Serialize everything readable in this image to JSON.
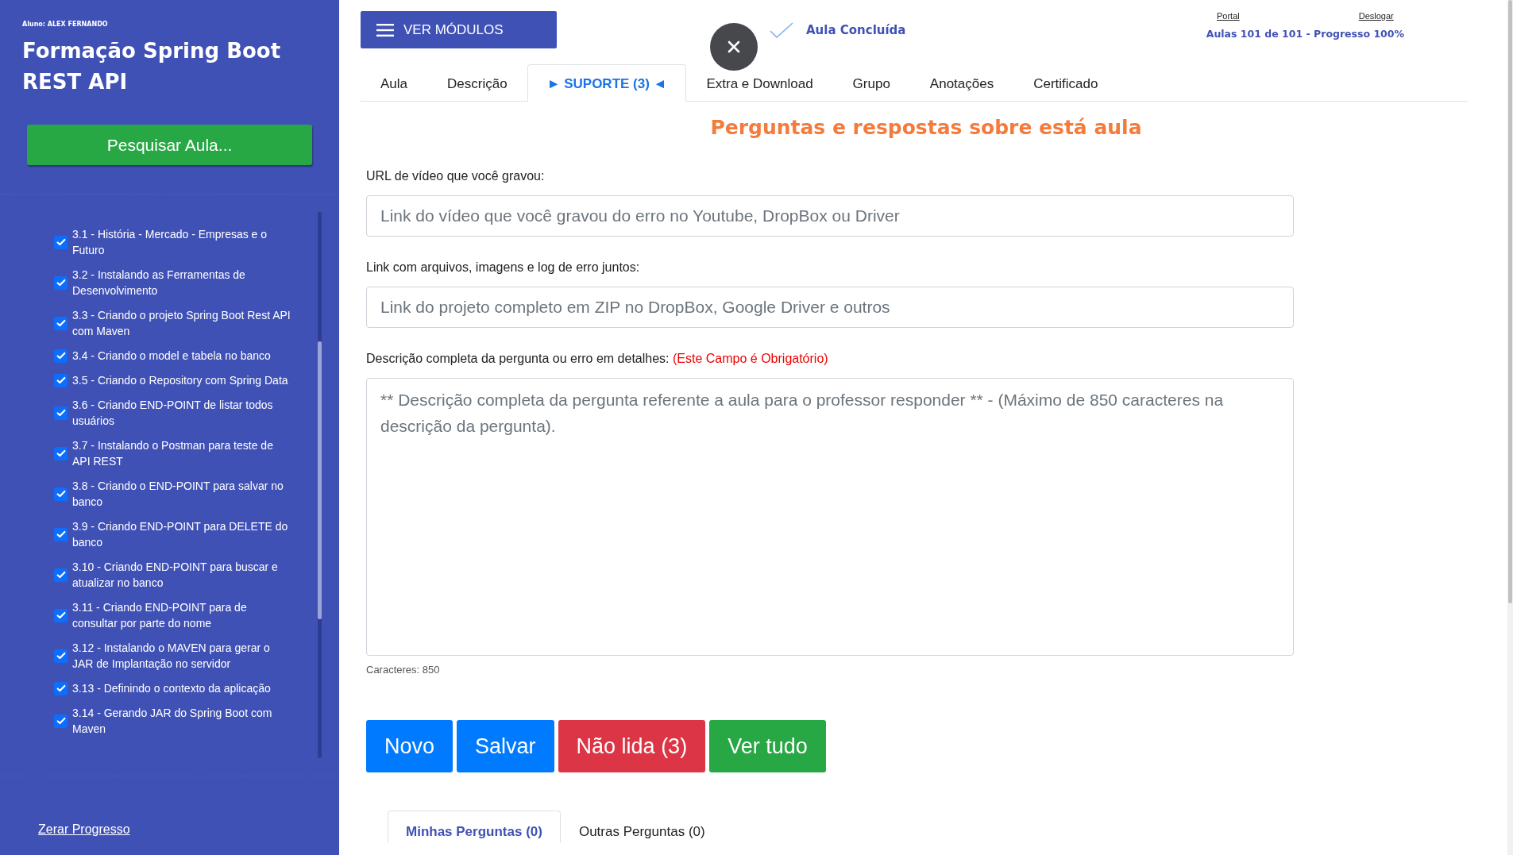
{
  "sidebar": {
    "student": "Aluno: ALEX FERNANDO",
    "course_title": "Formação Spring Boot REST API",
    "search_button": "Pesquisar Aula...",
    "lessons": [
      {
        "label": "3.1 - História - Mercado - Empresas e o Futuro",
        "checked": true
      },
      {
        "label": "3.2 - Instalando as Ferramentas de Desenvolvimento",
        "checked": true
      },
      {
        "label": "3.3 - Criando o projeto Spring Boot Rest API com Maven",
        "checked": true
      },
      {
        "label": "3.4 - Criando o model e tabela no banco",
        "checked": true
      },
      {
        "label": "3.5 - Criando o Repository com Spring Data",
        "checked": true
      },
      {
        "label": "3.6 - Criando END-POINT de listar todos usuários",
        "checked": true
      },
      {
        "label": "3.7 - Instalando o Postman para teste de API REST",
        "checked": true
      },
      {
        "label": "3.8 - Criando o END-POINT para salvar no banco",
        "checked": true
      },
      {
        "label": "3.9 - Criando END-POINT para DELETE do banco",
        "checked": true
      },
      {
        "label": "3.10 - Criando END-POINT para buscar e atualizar no banco",
        "checked": true
      },
      {
        "label": "3.11 - Criando END-POINT para de consultar por parte do nome",
        "checked": true
      },
      {
        "label": "3.12 - Instalando o MAVEN para gerar o JAR de Implantação no servidor",
        "checked": true
      },
      {
        "label": "3.13 - Definindo o contexto da aplicação",
        "checked": true
      },
      {
        "label": "3.14 - Gerando JAR do Spring Boot com Maven",
        "checked": true
      }
    ],
    "reset_link": "Zerar Progresso"
  },
  "header": {
    "modules_button": "VER MÓDULOS",
    "lesson_status": "Aula Concluída",
    "links": [
      "Portal",
      "Deslogar"
    ],
    "progress": "Aulas 101 de 101 - Progresso 100%"
  },
  "tabs": [
    {
      "label": "Aula",
      "selected": false
    },
    {
      "label": "Descrição",
      "selected": false
    },
    {
      "label": "► SUPORTE (3) ◄",
      "selected": true
    },
    {
      "label": "Extra e Download",
      "selected": false
    },
    {
      "label": "Grupo",
      "selected": false
    },
    {
      "label": "Anotações",
      "selected": false
    },
    {
      "label": "Certificado",
      "selected": false
    }
  ],
  "form": {
    "title": "Perguntas e respostas sobre está aula",
    "fields": [
      {
        "kind": "input",
        "label": "URL de vídeo que você gravou:",
        "placeholder": "Link do vídeo que você gravou do erro no Youtube, DropBox ou Driver"
      },
      {
        "kind": "input",
        "label": "Link com arquivos, imagens e log de erro juntos:",
        "placeholder": "Link do projeto completo em ZIP no DropBox, Google Driver e outros"
      },
      {
        "kind": "textarea",
        "label": "Descrição completa da pergunta ou erro em detalhes:",
        "required_note": "(Este Campo é Obrigatório)",
        "placeholder": "** Descrição completa da pergunta referente a aula para o professor responder ** - (Máximo de 850 caracteres na descrição da pergunta)."
      }
    ],
    "char_count": "Caracteres: 850",
    "buttons": [
      {
        "label": "Novo",
        "kind": "new"
      },
      {
        "label": "Salvar",
        "kind": "save"
      },
      {
        "label": "Não lida (3)",
        "kind": "unread"
      },
      {
        "label": "Ver tudo",
        "kind": "all"
      }
    ]
  },
  "question_tabs": [
    {
      "label": "Minhas Perguntas (0)",
      "selected": true
    },
    {
      "label": "Outras Perguntas (0)",
      "selected": false
    }
  ]
}
